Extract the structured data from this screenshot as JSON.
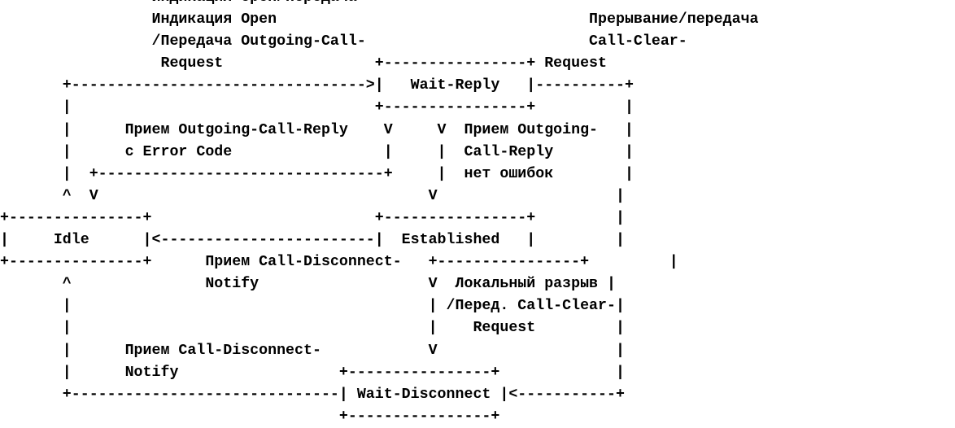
{
  "diagram": {
    "lines": [
      "                 Индикация Open/Передача",
      "                 Индикация Open                                   Прерывание/передача",
      "                 /Передача Outgoing-Call-                         Call-Clear-",
      "                  Request                 +----------------+ Request",
      "       +--------------------------------->|   Wait-Reply   |----------+",
      "       |                                  +----------------+          |",
      "       |      Прием Outgoing-Call-Reply    V     V  Прием Outgoing-   |",
      "       |      с Error Code                 |     |  Call-Reply        |",
      "       |  +--------------------------------+     |  нет ошибок        |",
      "       ^  V                                     V                    |",
      "+---------------+                         +----------------+         |",
      "|     Idle      |<------------------------|  Established   |         |",
      "+---------------+      Прием Call-Disconnect-   +----------------+         |",
      "       ^               Notify                   V  Локальный разрыв |",
      "       |                                        | /Перед. Call-Clear-|",
      "       |                                        |    Request         |",
      "       |      Прием Call-Disconnect-            V                    |",
      "       |      Notify                  +----------------+             |",
      "       +------------------------------| Wait-Disconnect |<-----------+",
      "                                      +----------------+"
    ]
  }
}
